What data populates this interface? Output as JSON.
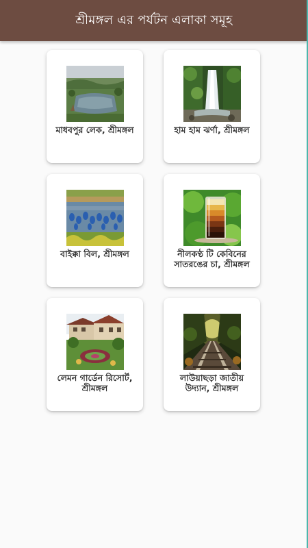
{
  "appbar": {
    "title": "শ্রীমঙ্গল এর পর্যটন এলাকা সমূহ"
  },
  "colors": {
    "appbar_bg": "#6d4c41",
    "background": "#fafafa",
    "card_bg": "#ffffff",
    "label_text": "#333333"
  },
  "places": [
    {
      "label": "মাধবপুর লেক, শ্রীমঙ্গল",
      "image": "lake-photo"
    },
    {
      "label": "হাম হাম ঝর্ণা, শ্রীমঙ্গল",
      "image": "waterfall-photo"
    },
    {
      "label": "বাইক্কা বিল, শ্রীমঙ্গল",
      "image": "wetland-birds-photo"
    },
    {
      "label": "নীলকণ্ঠ টি কেবিনের সাতরঙের চা, শ্রীমঙ্গল",
      "image": "seven-layer-tea-photo"
    },
    {
      "label": "লেমন গার্ডেন রিসোর্ট, শ্রীমঙ্গল",
      "image": "resort-garden-photo"
    },
    {
      "label": "লাউয়াছড়া জাতীয় উদ্যান, শ্রীমঙ্গল",
      "image": "forest-railway-photo"
    }
  ]
}
